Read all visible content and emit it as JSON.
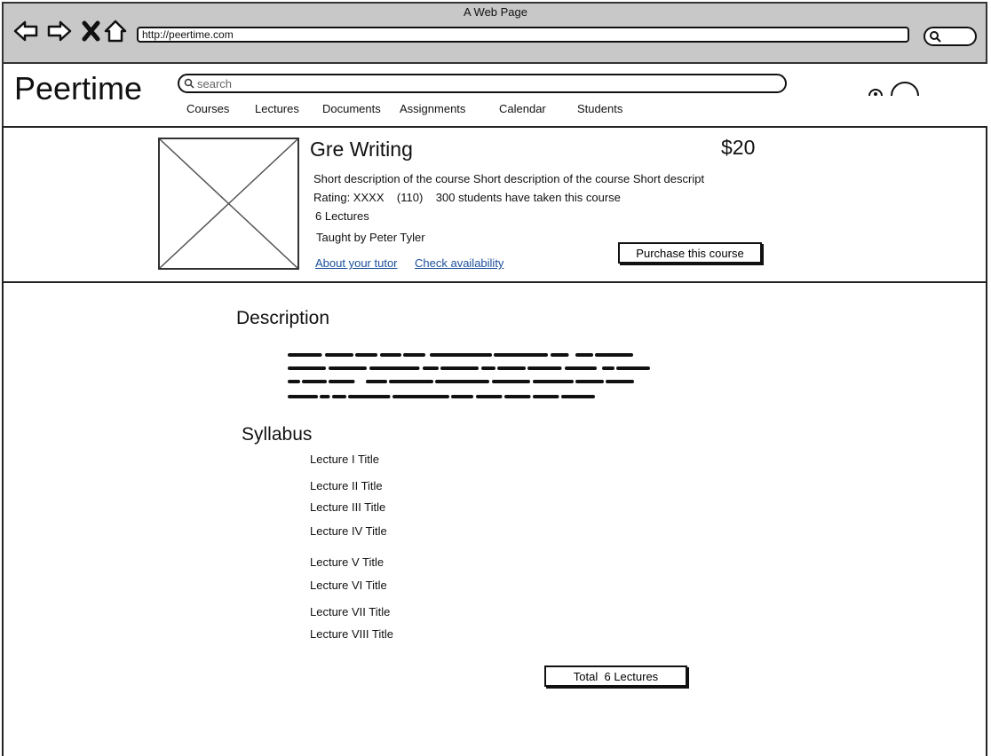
{
  "browser": {
    "window_title": "A Web Page",
    "url": "http://peertime.com",
    "icons": [
      "back-arrow-icon",
      "forward-arrow-icon",
      "close-icon",
      "home-icon",
      "search-icon"
    ]
  },
  "header": {
    "logo": "Peertime",
    "search_placeholder": "search",
    "nav": [
      {
        "label": "Courses"
      },
      {
        "label": "Lectures"
      },
      {
        "label": "Documents"
      },
      {
        "label": "Assignments"
      },
      {
        "label": "Calendar"
      },
      {
        "label": "Students"
      }
    ]
  },
  "course": {
    "title": "Gre Writing",
    "price": "$20",
    "short_description": "Short description of the course Short description of the course Short descript",
    "rating_line": "Rating: XXXX    (110)    300 students have taken this course",
    "lectures_count": "6 Lectures",
    "tutor_line": "Taught by Peter Tyler",
    "link_tutor": "About your tutor",
    "link_availability": "Check availability",
    "purchase_label": "Purchase this course"
  },
  "description": {
    "heading": "Description"
  },
  "syllabus": {
    "heading": "Syllabus",
    "lectures": [
      "Lecture I Title",
      "Lecture II Title",
      "Lecture III Title",
      "Lecture IV Title",
      "Lecture V Title",
      "Lecture VI Title",
      "Lecture VII Title",
      "Lecture VIII Title"
    ],
    "total_label": "Total  6 Lectures"
  }
}
